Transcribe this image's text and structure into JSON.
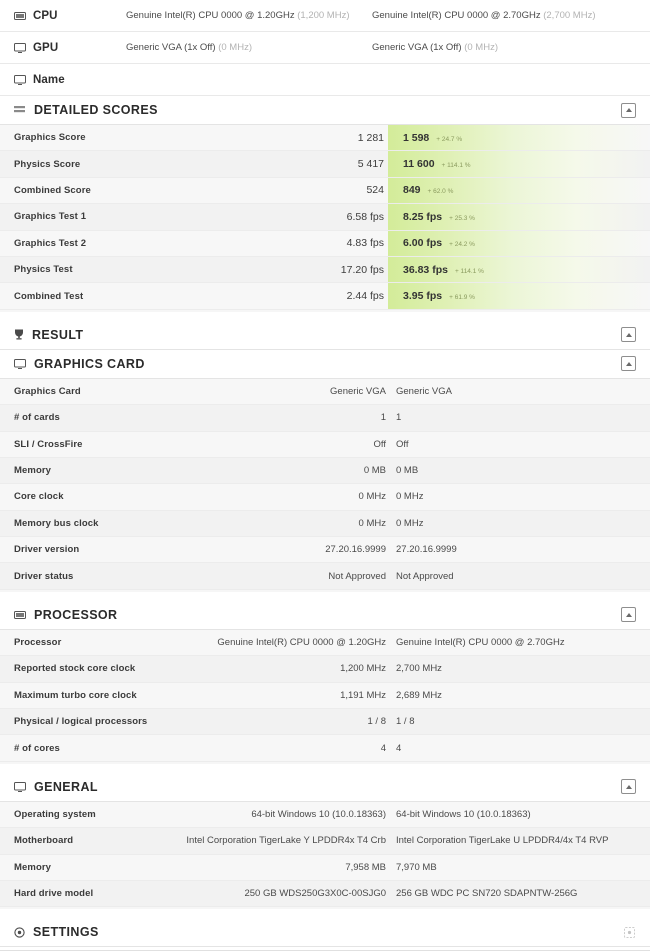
{
  "summary": {
    "rows": [
      {
        "label": "CPU",
        "icon": "cpu-icon",
        "col_a_main": "Genuine Intel(R) CPU 0000 @ 1.20GHz",
        "col_a_muted": "(1,200 MHz)",
        "col_b_main": "Genuine Intel(R) CPU 0000 @ 2.70GHz",
        "col_b_muted": "(2,700 MHz)"
      },
      {
        "label": "GPU",
        "icon": "monitor-icon",
        "col_a_main": "Generic VGA (1x Off)",
        "col_a_muted": "(0 MHz)",
        "col_b_main": "Generic VGA (1x Off)",
        "col_b_muted": "(0 MHz)"
      },
      {
        "label": "Name",
        "icon": "monitor-icon",
        "col_a_main": "",
        "col_a_muted": "",
        "col_b_main": "",
        "col_b_muted": ""
      }
    ]
  },
  "sections": {
    "detailed_scores": {
      "title": "DETAILED SCORES",
      "icon": "list-icon",
      "expander": "expand-button",
      "rows": [
        {
          "label": "Graphics Score",
          "value_a": "1 281",
          "value_b": "1 598",
          "delta": "+ 24.7 %"
        },
        {
          "label": "Physics Score",
          "value_a": "5 417",
          "value_b": "11 600",
          "delta": "+ 114.1 %"
        },
        {
          "label": "Combined Score",
          "value_a": "524",
          "value_b": "849",
          "delta": "+ 62.0 %"
        },
        {
          "label": "Graphics Test 1",
          "value_a": "6.58 fps",
          "value_b": "8.25 fps",
          "delta": "+ 25.3 %"
        },
        {
          "label": "Graphics Test 2",
          "value_a": "4.83 fps",
          "value_b": "6.00 fps",
          "delta": "+ 24.2 %"
        },
        {
          "label": "Physics Test",
          "value_a": "17.20 fps",
          "value_b": "36.83 fps",
          "delta": "+ 114.1 %"
        },
        {
          "label": "Combined Test",
          "value_a": "2.44 fps",
          "value_b": "3.95 fps",
          "delta": "+ 61.9 %"
        }
      ]
    },
    "result": {
      "title": "RESULT",
      "icon": "trophy-icon",
      "expander": "expand-button"
    },
    "graphics_card": {
      "title": "GRAPHICS CARD",
      "icon": "monitor-icon",
      "expander": "expand-button",
      "rows": [
        {
          "label": "Graphics Card",
          "value_a": "Generic VGA",
          "value_b": "Generic VGA"
        },
        {
          "label": "# of cards",
          "value_a": "1",
          "value_b": "1"
        },
        {
          "label": "SLI / CrossFire",
          "value_a": "Off",
          "value_b": "Off"
        },
        {
          "label": "Memory",
          "value_a": "0 MB",
          "value_b": "0 MB"
        },
        {
          "label": "Core clock",
          "value_a": "0 MHz",
          "value_b": "0 MHz"
        },
        {
          "label": "Memory bus clock",
          "value_a": "0 MHz",
          "value_b": "0 MHz"
        },
        {
          "label": "Driver version",
          "value_a": "27.20.16.9999",
          "value_b": "27.20.16.9999"
        },
        {
          "label": "Driver status",
          "value_a": "Not Approved",
          "value_b": "Not Approved"
        }
      ]
    },
    "processor": {
      "title": "PROCESSOR",
      "icon": "cpu-icon",
      "expander": "expand-button",
      "rows": [
        {
          "label": "Processor",
          "value_a": "Genuine Intel(R) CPU 0000 @ 1.20GHz",
          "value_b": "Genuine Intel(R) CPU 0000 @ 2.70GHz"
        },
        {
          "label": "Reported stock core clock",
          "value_a": "1,200 MHz",
          "value_b": "2,700 MHz"
        },
        {
          "label": "Maximum turbo core clock",
          "value_a": "1,191 MHz",
          "value_b": "2,689 MHz"
        },
        {
          "label": "Physical / logical processors",
          "value_a": "1 / 8",
          "value_b": "1 / 8"
        },
        {
          "label": "# of cores",
          "value_a": "4",
          "value_b": "4"
        }
      ]
    },
    "general": {
      "title": "GENERAL",
      "icon": "monitor-icon",
      "expander": "expand-button",
      "rows": [
        {
          "label": "Operating system",
          "value_a": "64-bit Windows 10 (10.0.18363)",
          "value_b": "64-bit Windows 10 (10.0.18363)"
        },
        {
          "label": "Motherboard",
          "value_a": "Intel Corporation TigerLake Y LPDDR4x T4 Crb",
          "value_b": "Intel Corporation TigerLake U LPDDR4/4x T4 RVP"
        },
        {
          "label": "Memory",
          "value_a": "7,958 MB",
          "value_b": "7,970 MB"
        },
        {
          "label": "Hard drive model",
          "value_a": "250 GB WDS250G3X0C-00SJG0",
          "value_b": "256 GB WDC PC SN720 SDAPNTW-256G"
        }
      ]
    },
    "settings": {
      "title": "SETTINGS",
      "icon": "gear-icon",
      "expander": "expand-button"
    }
  },
  "colors": {
    "highlight_green": "#d3ec99",
    "delta_text": "#8a9a5e",
    "row_bg_odd": "#f7f7f7",
    "row_bg_even": "#f2f2f2"
  }
}
